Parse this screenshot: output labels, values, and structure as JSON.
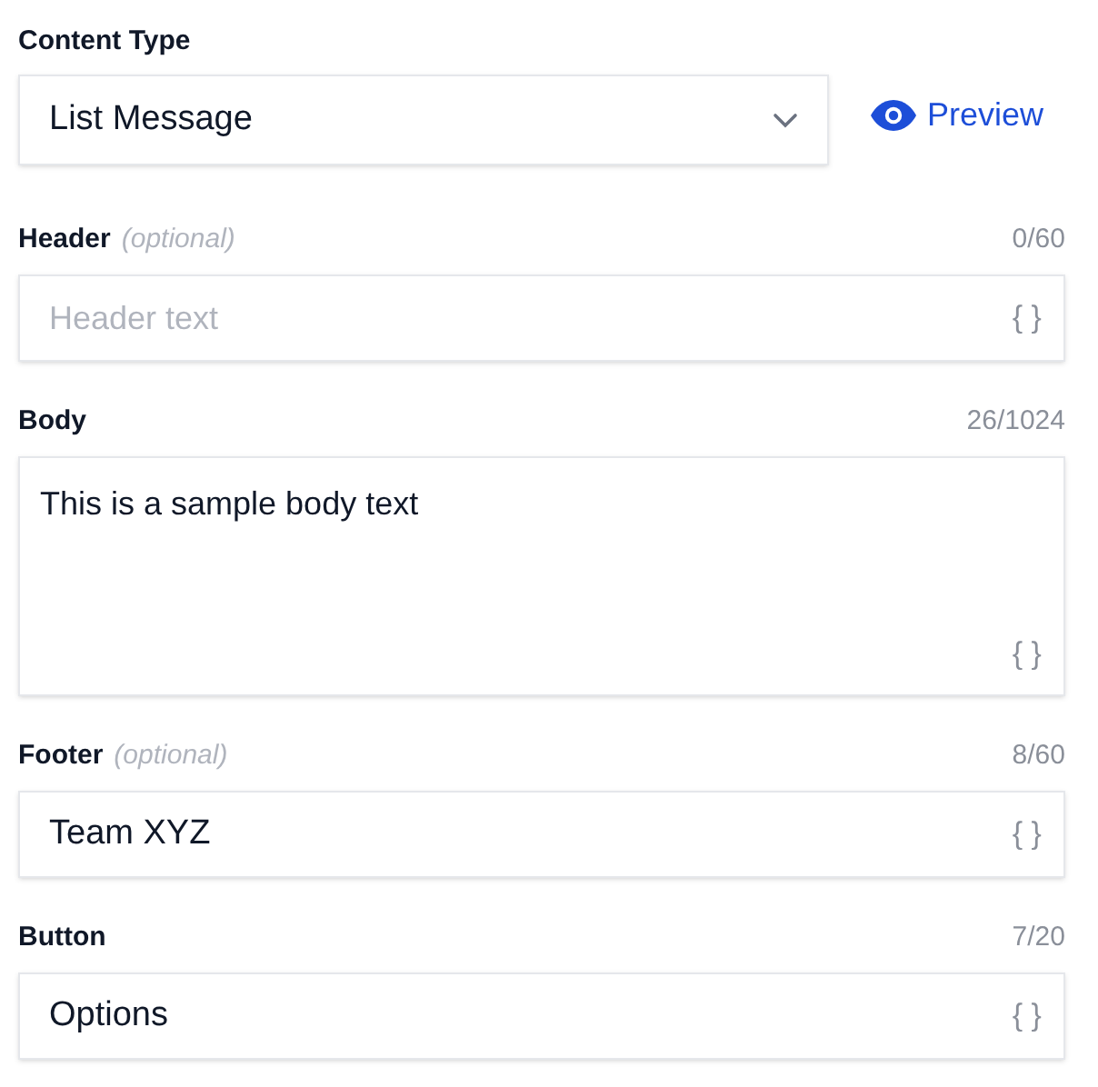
{
  "content_type": {
    "label": "Content Type",
    "value": "List Message",
    "preview": "Preview"
  },
  "fields": [
    {
      "kind": "input",
      "label": "Header",
      "optional": "(optional)",
      "count": "0/60",
      "placeholder": "Header text",
      "variable": "{ }"
    },
    {
      "kind": "textarea",
      "label": "Body",
      "count": "26/1024",
      "value": "This is a sample body text",
      "variable": "{ }"
    },
    {
      "kind": "input",
      "label": "Footer",
      "optional": "(optional)",
      "count": "8/60",
      "value": "Team XYZ",
      "variable": "{ }"
    },
    {
      "kind": "input",
      "label": "Button",
      "count": "7/20",
      "value": "Options",
      "variable": "{ }"
    }
  ]
}
